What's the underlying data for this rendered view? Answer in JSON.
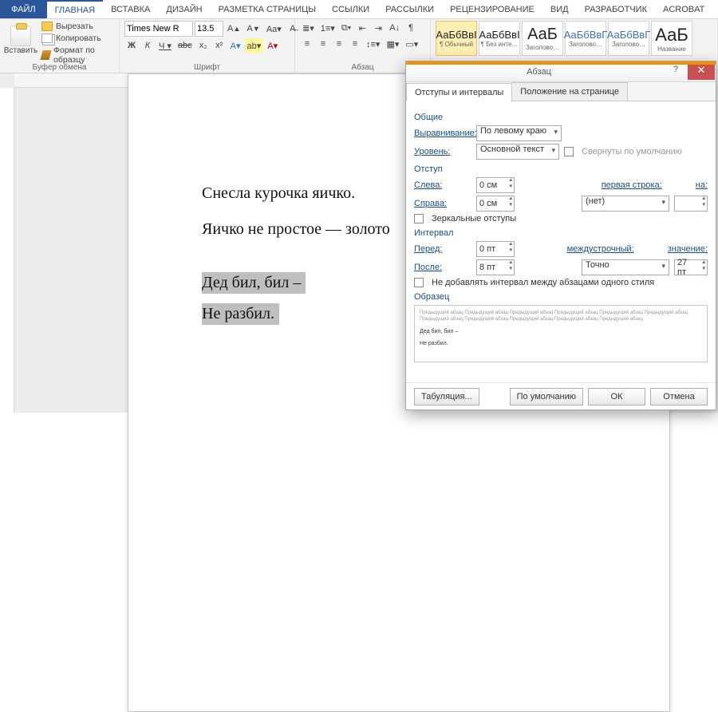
{
  "tabs": {
    "file": "ФАЙЛ",
    "home": "ГЛАВНАЯ",
    "insert": "ВСТАВКА",
    "design": "ДИЗАЙН",
    "layout": "РАЗМЕТКА СТРАНИЦЫ",
    "refs": "ССЫЛКИ",
    "mail": "РАССЫЛКИ",
    "review": "РЕЦЕНЗИРОВАНИЕ",
    "view": "ВИД",
    "dev": "РАЗРАБОТЧИК",
    "acrobat": "ACROBAT"
  },
  "ribbon": {
    "clipboard": {
      "label": "Буфер обмена",
      "paste": "Вставить",
      "cut": "Вырезать",
      "copy": "Копировать",
      "format": "Формат по образцу"
    },
    "font": {
      "label": "Шрифт",
      "name": "Times New R",
      "size": "13.5"
    },
    "paragraph": {
      "label": "Абзац"
    },
    "styles": {
      "normal": "¶ Обычный",
      "nospace": "¶ Без инте…",
      "h1": "Заголово…",
      "h2": "Заголово…",
      "h3": "Заголово…",
      "title": "Название"
    }
  },
  "styles_sample": {
    "cyr": "АаБбВвІ",
    "cyr2": "АаБбВвІ",
    "big": "АаБ",
    "blue": "АаБбВвГ",
    "blue2": "АаБбВвГ",
    "huge": "АаБ"
  },
  "doc": {
    "p1": "Снесла курочка яичко.",
    "p2": "Яичко не простое — золото",
    "p3": "Дед бил, бил –",
    "p4": "Не разбил."
  },
  "dialog": {
    "title": "Абзац",
    "tab1": "Отступы и интервалы",
    "tab2": "Положение на странице",
    "sec_general": "Общие",
    "align_lbl": "Выравнивание:",
    "align_val": "По левому краю",
    "level_lbl": "Уровень:",
    "level_val": "Основной текст",
    "collapse": "Свернуты по умолчанию",
    "sec_indent": "Отступ",
    "left_lbl": "Слева:",
    "left_val": "0 см",
    "right_lbl": "Справа:",
    "right_val": "0 см",
    "firstline_lbl": "первая строка:",
    "firstline_val": "(нет)",
    "by_lbl": "на:",
    "mirror": "Зеркальные отступы",
    "sec_spacing": "Интервал",
    "before_lbl": "Перед:",
    "before_val": "0 пт",
    "after_lbl": "После:",
    "after_val": "8 пт",
    "linesp_lbl": "междустрочный:",
    "linesp_val": "Точно",
    "value_lbl": "значение:",
    "value_val": "27 пт",
    "noadd": "Не добавлять интервал между абзацами одного стиля",
    "sec_preview": "Образец",
    "preview_lorem": "Предыдущий абзац Предыдущий абзац Предыдущий абзац Предыдущий абзац Предыдущий абзац Предыдущий абзац Предыдущий абзац Предыдущий абзац Предыдущий абзац Предыдущий абзац Предыдущий абзац",
    "preview_l1": "Дед бил, бил –",
    "preview_l2": "Не разбил.",
    "btn_tabs": "Табуляция...",
    "btn_default": "По умолчанию",
    "btn_ok": "ОК",
    "btn_cancel": "Отмена"
  }
}
